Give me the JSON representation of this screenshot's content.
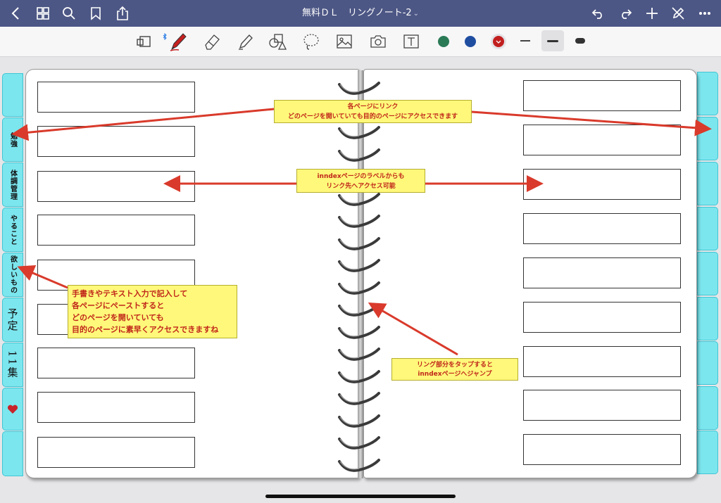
{
  "window": {
    "title": "無料ＤＬ　リングノート-2",
    "title_chevron": "⌄"
  },
  "nav_left": [
    "back-icon",
    "grid-icon",
    "search-icon",
    "bookmark-icon",
    "share-icon"
  ],
  "nav_right": [
    "undo-icon",
    "redo-icon",
    "plus-icon",
    "pen-off-icon",
    "more-icon"
  ],
  "tools": [
    "read-only-icon",
    "pen-icon",
    "eraser-icon",
    "highlighter-icon",
    "shapes-icon",
    "lasso-icon",
    "image-icon",
    "camera-icon",
    "textbox-icon"
  ],
  "colors": {
    "green": "#2b7a56",
    "blue": "#1f4ea1",
    "red": "#c21e1e",
    "tab": "#7ce6ee",
    "note": "#fff87a",
    "arrow": "#d93a2b",
    "titlebar": "#4d5785"
  },
  "tabs_left": [
    {
      "label": "",
      "style": ""
    },
    {
      "label": "勉強",
      "style": ""
    },
    {
      "label": "体調管理",
      "style": ""
    },
    {
      "label": "やること",
      "style": ""
    },
    {
      "label": "欲しいもの",
      "style": ""
    },
    {
      "label": "予定",
      "style": "hand"
    },
    {
      "label": "11集",
      "style": "hand"
    },
    {
      "label": "",
      "style": "heart"
    },
    {
      "label": "",
      "style": ""
    }
  ],
  "notes": {
    "link_each_page": [
      "各ページにリンク",
      "どのページを開いていても目的のページにアクセスできます"
    ],
    "index_label": [
      "inndexページのラベルからも",
      "リンク先へアクセス可能"
    ],
    "handwrite": [
      "手書きやテキスト入力で記入して",
      "各ページにペーストすると",
      "どのページを開いていても",
      "目的のページに素早くアクセスできますね"
    ],
    "ring_jump": [
      "リング部分をタップすると",
      "inndexページへジャンプ"
    ]
  }
}
